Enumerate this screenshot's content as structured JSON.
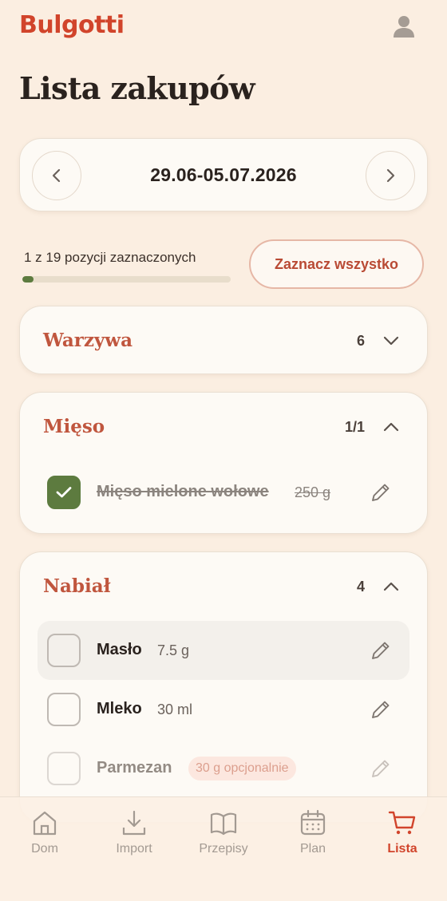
{
  "app": {
    "logo": "Bulgotti"
  },
  "page": {
    "title": "Lista zakupów"
  },
  "date_nav": {
    "range": "29.06-05.07.2026"
  },
  "progress": {
    "label": "1 z 19 pozycji zaznaczonych",
    "checked": 1,
    "total": 19
  },
  "select_all_label": "Zaznacz wszystko",
  "sections": [
    {
      "title": "Warzywa",
      "count": "6",
      "expanded": false
    },
    {
      "title": "Mięso",
      "count": "1/1",
      "expanded": true,
      "items": [
        {
          "name": "Mięso mielone wołowe",
          "qty": "250 g",
          "checked": true
        }
      ]
    },
    {
      "title": "Nabiał",
      "count": "4",
      "expanded": true,
      "items": [
        {
          "name": "Masło",
          "qty": "7.5 g",
          "checked": false
        },
        {
          "name": "Mleko",
          "qty": "30 ml",
          "checked": false
        },
        {
          "name": "Parmezan",
          "qty": "30 g opcjonalnie",
          "checked": false,
          "optional": true
        }
      ]
    }
  ],
  "bottom_nav": [
    {
      "label": "Dom",
      "icon": "home-icon"
    },
    {
      "label": "Import",
      "icon": "download-icon"
    },
    {
      "label": "Przepisy",
      "icon": "book-icon"
    },
    {
      "label": "Plan",
      "icon": "calendar-icon"
    },
    {
      "label": "Lista",
      "icon": "cart-icon",
      "active": true
    }
  ],
  "colors": {
    "background": "#fbeee1",
    "accent": "#d1442b",
    "section_title": "#c0563e",
    "checked": "#5d7b3f"
  }
}
